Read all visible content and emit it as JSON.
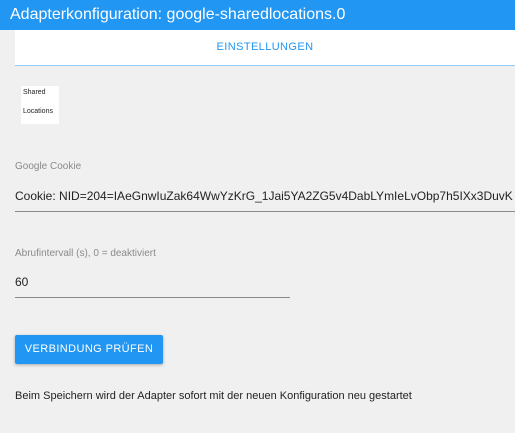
{
  "window": {
    "title": "Adapterkonfiguration: google-sharedlocations.0"
  },
  "tabs": [
    {
      "label": "EINSTELLUNGEN",
      "active": true
    }
  ],
  "logo": {
    "line1": "Shared",
    "line2": "Locations"
  },
  "cookie": {
    "label": "Google Cookie",
    "value": "Cookie: NID=204=IAeGnwIuZak64WwYzKrG_1Jai5YA2ZG5v4DabLYmIeLvObp7h5IXx3DuvK"
  },
  "interval": {
    "label": "Abrufintervall (s), 0 = deaktiviert",
    "value": "60"
  },
  "check_button": {
    "label": "VERBINDUNG PRÜFEN"
  },
  "note": "Beim Speichern wird der Adapter sofort mit der neuen Konfiguration neu gestartet",
  "colors": {
    "accent": "#2196f3",
    "background": "#f0f0f0"
  }
}
